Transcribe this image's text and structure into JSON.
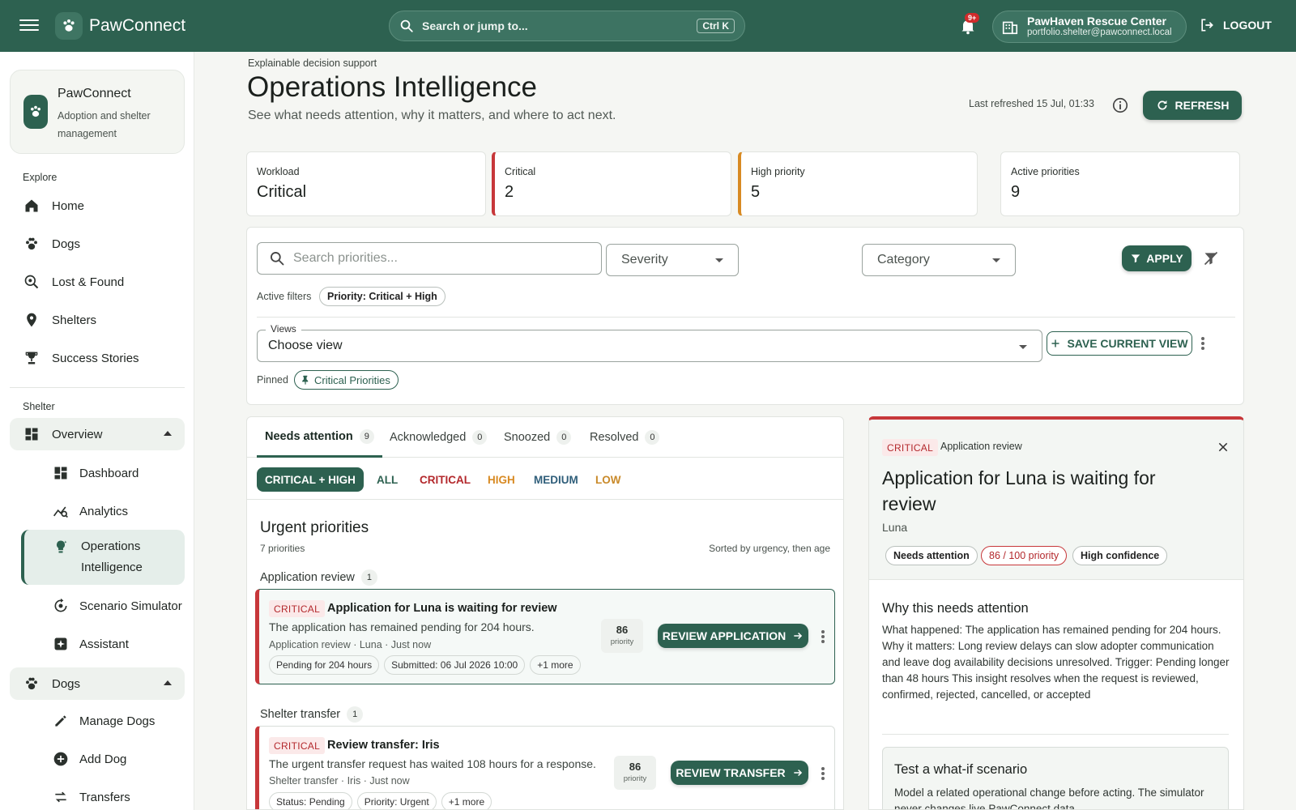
{
  "topbar": {
    "brand": "PawConnect",
    "search_placeholder": "Search or jump to...",
    "search_shortcut": "Ctrl K",
    "notification_badge": "9+",
    "org_name": "PawHaven Rescue Center",
    "org_email": "portfolio.shelter@pawconnect.local",
    "logout_label": "LOGOUT"
  },
  "sidebar": {
    "card_title": "PawConnect",
    "card_subtitle": "Adoption and shelter management",
    "explore_label": "Explore",
    "explore_items": [
      {
        "label": "Home",
        "icon": "home-icon"
      },
      {
        "label": "Dogs",
        "icon": "paw-icon"
      },
      {
        "label": "Lost & Found",
        "icon": "search-location-icon"
      },
      {
        "label": "Shelters",
        "icon": "location-pin-icon"
      },
      {
        "label": "Success Stories",
        "icon": "trophy-icon"
      }
    ],
    "shelter_label": "Shelter",
    "overview_group": "Overview",
    "overview_items": [
      {
        "label": "Dashboard",
        "icon": "dashboard-icon"
      },
      {
        "label": "Analytics",
        "icon": "analytics-icon"
      },
      {
        "label": "Operations Intelligence",
        "icon": "lightbulb-icon"
      },
      {
        "label": "Scenario Simulator",
        "icon": "simulator-icon"
      },
      {
        "label": "Assistant",
        "icon": "assistant-icon"
      }
    ],
    "dogs_group": "Dogs",
    "dogs_items": [
      {
        "label": "Manage Dogs",
        "icon": "pencil-icon"
      },
      {
        "label": "Add Dog",
        "icon": "plus-circle-icon"
      },
      {
        "label": "Transfers",
        "icon": "transfer-icon"
      }
    ]
  },
  "header": {
    "eyebrow": "Explainable decision support",
    "title": "Operations Intelligence",
    "subtitle": "See what needs attention, why it matters, and where to act next.",
    "last_refreshed": "Last refreshed 15 Jul, 01:33",
    "refresh_label": "REFRESH"
  },
  "stats": [
    {
      "label": "Workload",
      "value": "Critical"
    },
    {
      "label": "Critical",
      "value": "2"
    },
    {
      "label": "High priority",
      "value": "5"
    },
    {
      "label": "Active priorities",
      "value": "9"
    }
  ],
  "filters": {
    "search_placeholder": "Search priorities...",
    "severity_label": "Severity",
    "category_label": "Category",
    "apply_label": "APPLY",
    "active_filters_label": "Active filters",
    "active_filter_chip": "Priority: Critical + High",
    "views_legend": "Views",
    "views_value": "Choose view",
    "save_view_label": "SAVE CURRENT VIEW",
    "pinned_label": "Pinned",
    "pinned_chip": "Critical Priorities"
  },
  "list": {
    "tabs": [
      {
        "label": "Needs attention",
        "count": "9"
      },
      {
        "label": "Acknowledged",
        "count": "0"
      },
      {
        "label": "Snoozed",
        "count": "0"
      },
      {
        "label": "Resolved",
        "count": "0"
      }
    ],
    "severity_filters": [
      {
        "label": "CRITICAL + HIGH",
        "color": "#ffffff"
      },
      {
        "label": "ALL",
        "color": "#2d6150"
      },
      {
        "label": "CRITICAL",
        "color": "#b3282c"
      },
      {
        "label": "HIGH",
        "color": "#d88a23"
      },
      {
        "label": "MEDIUM",
        "color": "#2f5e7a"
      },
      {
        "label": "LOW",
        "color": "#c98a2a"
      }
    ],
    "heading": "Urgent priorities",
    "count_text": "7 priorities",
    "sorted_text": "Sorted by urgency, then age",
    "groups": [
      {
        "label": "Application review",
        "count": "1",
        "card": {
          "badge": "CRITICAL",
          "title": "Application for Luna is waiting for review",
          "description": "The application has remained pending for 204 hours.",
          "meta": "Application review · Luna · Just now",
          "tags": [
            "Pending for 204 hours",
            "Submitted: 06 Jul 2026 10:00",
            "+1 more"
          ],
          "score": "86",
          "score_label": "priority",
          "action": "REVIEW APPLICATION"
        }
      },
      {
        "label": "Shelter transfer",
        "count": "1",
        "card": {
          "badge": "CRITICAL",
          "title": "Review transfer: Iris",
          "description": "The urgent transfer request has waited 108 hours for a response.",
          "meta": "Shelter transfer · Iris · Just now",
          "tags": [
            "Status: Pending",
            "Priority: Urgent",
            "+1 more"
          ],
          "score": "86",
          "score_label": "priority",
          "action": "REVIEW TRANSFER"
        }
      }
    ]
  },
  "detail": {
    "badge": "CRITICAL",
    "category": "Application review",
    "title": "Application for Luna is waiting for review",
    "dog": "Luna",
    "chips": [
      "Needs attention",
      "86 / 100 priority",
      "High confidence"
    ],
    "why_title": "Why this needs attention",
    "why_text": "What happened: The application has remained pending for 204 hours. Why it matters: Long review delays can slow adopter communication and leave dog availability decisions unresolved. Trigger: Pending longer than 48 hours This insight resolves when the request is reviewed, confirmed, rejected, cancelled, or accepted",
    "whatif_title": "Test a what-if scenario",
    "whatif_text": "Model a related operational change before acting. The simulator never changes live PawConnect data."
  },
  "colors": {
    "brand": "#2d6150",
    "critical": "#c7373a",
    "high": "#d88a23"
  }
}
